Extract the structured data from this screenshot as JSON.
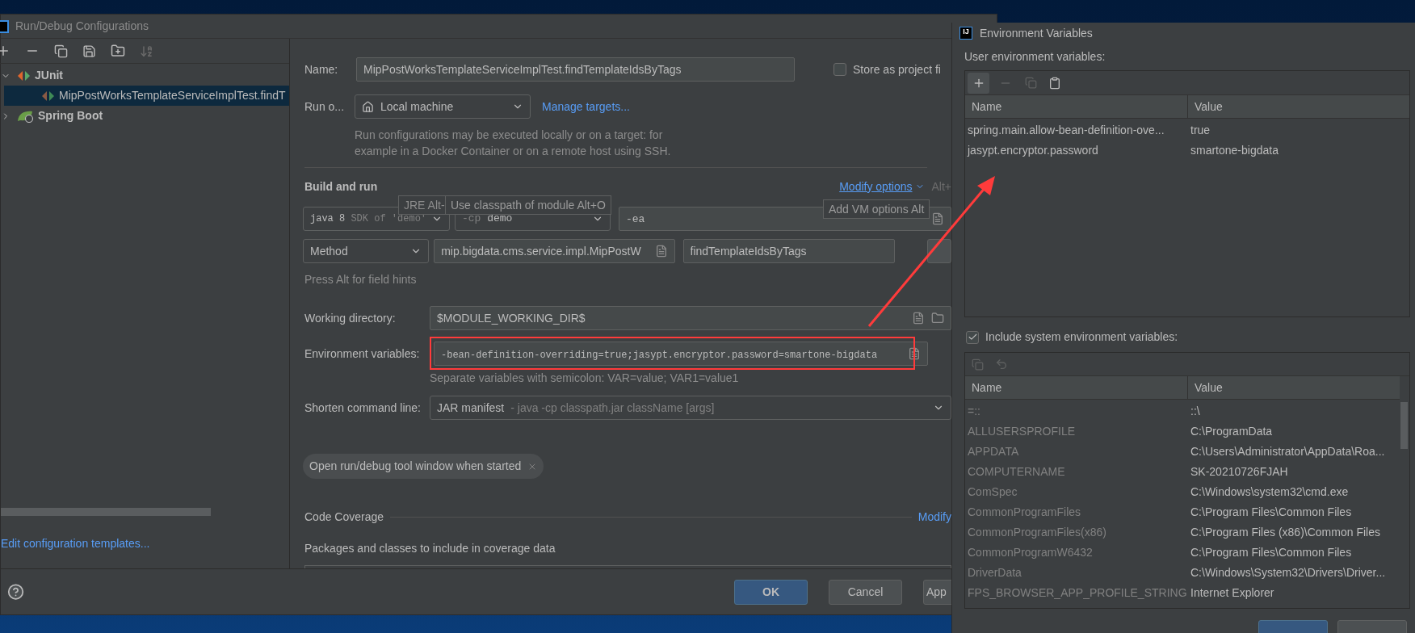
{
  "main_dialog": {
    "title": "Run/Debug Configurations",
    "tree": [
      {
        "label": "JUnit",
        "kind": "junit",
        "expanded": true,
        "selected": false,
        "children": [
          {
            "label": "MipPostWorksTemplateServiceImplTest.findT",
            "kind": "junit-test",
            "selected": true
          }
        ]
      },
      {
        "label": "Spring Boot",
        "kind": "spring",
        "expanded": false,
        "selected": false
      }
    ],
    "edit_templates_link": "Edit configuration templates...",
    "form": {
      "name": {
        "label": "Name:",
        "value": "MipPostWorksTemplateServiceImplTest.findTemplateIdsByTags"
      },
      "store_as_project": {
        "label": "Store as project fi",
        "checked": false
      },
      "run_on": {
        "label": "Run o...",
        "value": "Local machine",
        "link": "Manage targets...",
        "hint": "Run configurations may be executed locally or on a target: for example in a Docker Container or on a remote host using SSH."
      },
      "build_and_run": {
        "title": "Build and run",
        "modify_options_link": "Modify options",
        "modify_options_shortcut": "Alt+",
        "jre_value": "java 8",
        "jre_hint": "SDK of 'demo'",
        "classpath_prefix": "-cp",
        "classpath_value": "demo",
        "vm_options": "-ea",
        "test_kind": "Method",
        "class_value": "mip.bigdata.cms.service.impl.MipPostW",
        "method_value": "findTemplateIdsByTags",
        "field_hint": "Press Alt for field hints"
      },
      "tooltips": [
        "JRE Alt-",
        "Use classpath of module Alt+O",
        "Add VM options Alt"
      ],
      "working_directory": {
        "label": "Working directory:",
        "value": "$MODULE_WORKING_DIR$"
      },
      "environment_variables": {
        "label": "Environment variables:",
        "value": "-bean-definition-overriding=true;jasypt.encryptor.password=smartone-bigdata",
        "hint": "Separate variables with semicolon: VAR=value; VAR1=value1"
      },
      "shorten_command_line": {
        "label": "Shorten command line:",
        "value": "JAR manifest",
        "description": "- java -cp classpath.jar className [args]"
      },
      "option_chips": [
        "Open run/debug tool window when started"
      ],
      "code_coverage": {
        "title": "Code Coverage",
        "modify_link": "Modify",
        "packages_label": "Packages and classes to include in coverage data"
      }
    },
    "buttons": [
      {
        "label": "OK",
        "kind": "primary"
      },
      {
        "label": "Cancel",
        "kind": "default"
      },
      {
        "label": "App",
        "kind": "default"
      }
    ]
  },
  "env_dialog": {
    "icon_text": "IJ",
    "title": "Environment Variables",
    "user_label": "User environment variables:",
    "user_table": {
      "columns": [
        "Name",
        "Value"
      ],
      "rows": [
        {
          "name": "spring.main.allow-bean-definition-ove...",
          "value": "true"
        },
        {
          "name": "jasypt.encryptor.password",
          "value": "smartone-bigdata"
        }
      ]
    },
    "include_system": {
      "label": "Include system environment variables:",
      "checked": true
    },
    "system_table": {
      "columns": [
        "Name",
        "Value"
      ],
      "rows": [
        {
          "name": "=::",
          "value": "::\\"
        },
        {
          "name": "ALLUSERSPROFILE",
          "value": "C:\\ProgramData"
        },
        {
          "name": "APPDATA",
          "value": "C:\\Users\\Administrator\\AppData\\Roa..."
        },
        {
          "name": "COMPUTERNAME",
          "value": "SK-20210726FJAH"
        },
        {
          "name": "ComSpec",
          "value": "C:\\Windows\\system32\\cmd.exe"
        },
        {
          "name": "CommonProgramFiles",
          "value": "C:\\Program Files\\Common Files"
        },
        {
          "name": "CommonProgramFiles(x86)",
          "value": "C:\\Program Files (x86)\\Common Files"
        },
        {
          "name": "CommonProgramW6432",
          "value": "C:\\Program Files\\Common Files"
        },
        {
          "name": "DriverData",
          "value": "C:\\Windows\\System32\\Drivers\\Driver..."
        },
        {
          "name": "FPS_BROWSER_APP_PROFILE_STRING",
          "value": "Internet Explorer"
        }
      ]
    }
  }
}
